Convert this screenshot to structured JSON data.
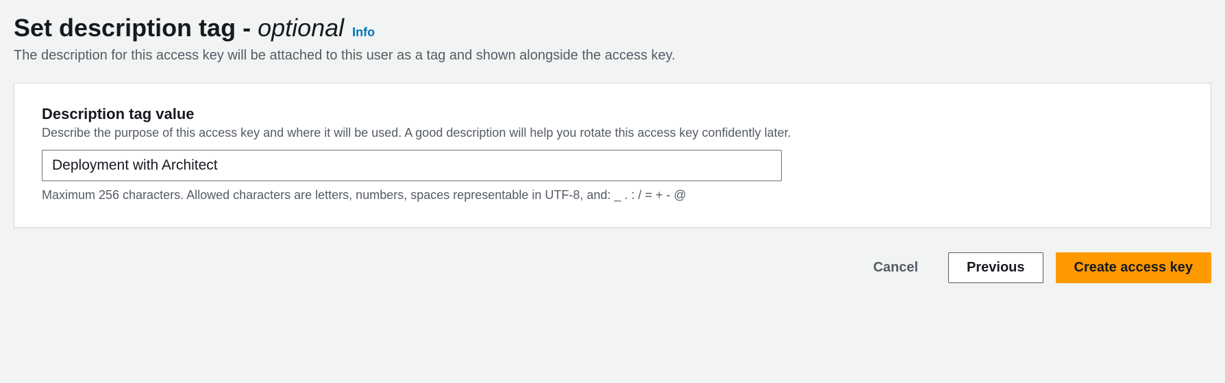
{
  "header": {
    "title_prefix": "Set description tag",
    "title_separator": " - ",
    "title_suffix": "optional",
    "info_label": "Info",
    "description": "The description for this access key will be attached to this user as a tag and shown alongside the access key."
  },
  "form": {
    "field_label": "Description tag value",
    "field_hint": "Describe the purpose of this access key and where it will be used. A good description will help you rotate this access key confidently later.",
    "field_value": "Deployment with Architect",
    "field_constraint": "Maximum 256 characters. Allowed characters are letters, numbers, spaces representable in UTF-8, and: _ . : / = + - @"
  },
  "buttons": {
    "cancel": "Cancel",
    "previous": "Previous",
    "create": "Create access key"
  }
}
